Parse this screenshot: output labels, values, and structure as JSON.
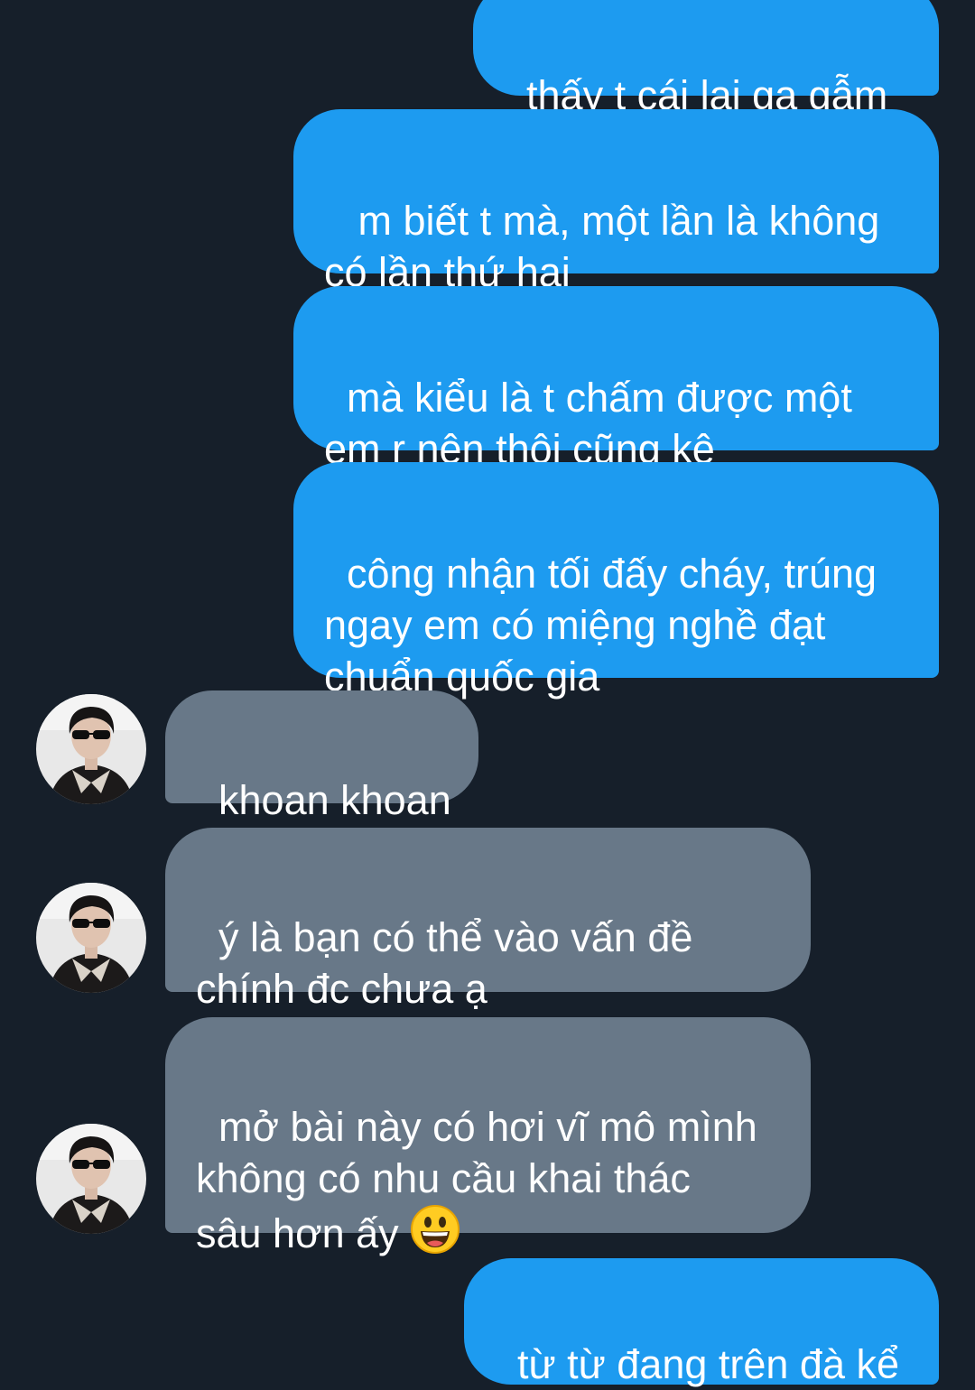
{
  "conversation": {
    "messages": [
      {
        "sender": "me",
        "text": "thấy t cái lại gạ gẫm"
      },
      {
        "sender": "me",
        "text": " m biết t mà, một lần là không\ncó lần thứ hai"
      },
      {
        "sender": "me",
        "text": "mà kiểu là t chấm được một\nem r nên thôi cũng kệ"
      },
      {
        "sender": "me",
        "text": "công nhận tối đấy cháy, trúng\nngay em có miệng nghề đạt\nchuẩn quốc gia"
      },
      {
        "sender": "other",
        "text": "khoan khoan"
      },
      {
        "sender": "other",
        "text": "ý là bạn có thể vào vấn đề\nchính đc chưa ạ"
      },
      {
        "sender": "other",
        "text": "mở bài này có hơi vĩ mô mình\nkhông có nhu cầu khai thác\nsâu hơn ấy ",
        "emoji": "grinning-face-emoji"
      },
      {
        "sender": "me",
        "text": "từ từ đang trên đà kể"
      }
    ]
  },
  "colors": {
    "background": "#161f2a",
    "outgoing_bubble": "#1d9bf0",
    "incoming_bubble": "#687888",
    "text": "#ffffff"
  },
  "icons": {
    "avatar": "contact-avatar",
    "emoji": "grinning-face-emoji"
  }
}
